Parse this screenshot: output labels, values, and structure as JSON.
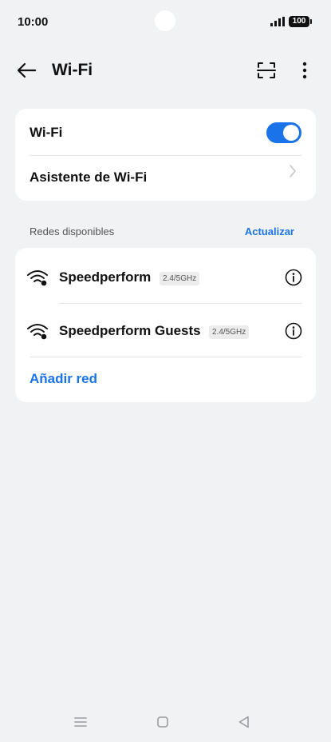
{
  "status_bar": {
    "time": "10:00",
    "battery": "100",
    "icons": [
      "signal-icon",
      "battery-icon"
    ]
  },
  "header": {
    "title": "Wi-Fi",
    "icons": [
      "back-arrow-icon",
      "scan-qr-icon",
      "more-vert-icon"
    ]
  },
  "wifi_card": {
    "toggle_label": "Wi-Fi",
    "toggle_on": true,
    "assistant_label": "Asistente de Wi-Fi"
  },
  "networks_section": {
    "title": "Redes disponibles",
    "refresh_label": "Actualizar",
    "networks": [
      {
        "name": "Speedperform",
        "band": "2.4/5GHz"
      },
      {
        "name": "Speedperform Guests",
        "band": "2.4/5GHz"
      }
    ],
    "add_label": "Añadir red"
  },
  "nav_bar": {
    "icons": [
      "recents-menu-icon",
      "home-icon",
      "back-triangle-icon"
    ]
  },
  "colors": {
    "accent": "#1a73e8",
    "background": "#f1f2f4",
    "card": "#ffffff"
  }
}
